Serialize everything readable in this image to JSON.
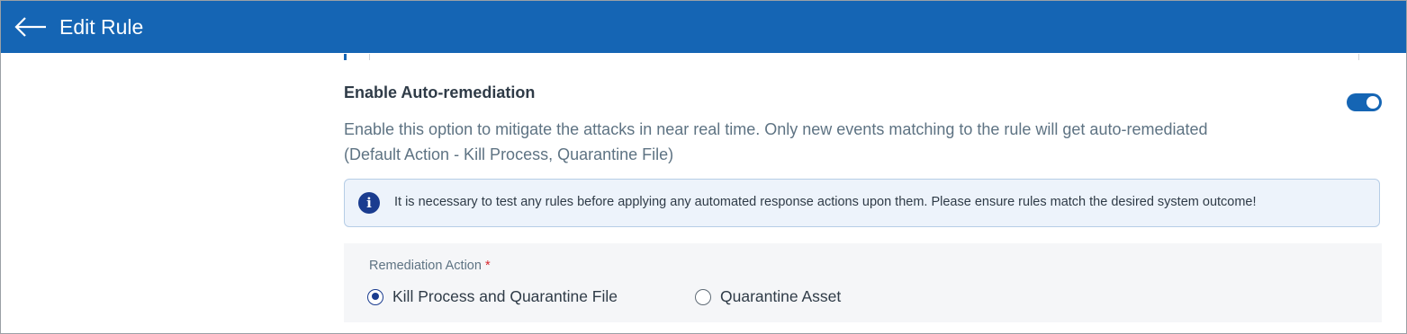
{
  "header": {
    "title": "Edit Rule",
    "back_icon": "arrow-left-icon",
    "background": "#1565b4"
  },
  "auto_remediation": {
    "title": "Enable Auto-remediation",
    "description_line1": "Enable this option to mitigate the attacks in near real time. Only new events matching to the rule will get auto-remediated",
    "description_line2": "(Default Action - Kill Process, Quarantine File)",
    "enabled": true
  },
  "info_banner": {
    "icon": "info-icon",
    "message": "It is necessary to test any rules before applying any automated response actions upon them. Please ensure rules match the desired system outcome!"
  },
  "remediation_action": {
    "label": "Remediation Action",
    "required_marker": "*",
    "options": [
      {
        "label": "Kill Process and Quarantine File",
        "selected": true
      },
      {
        "label": "Quarantine Asset",
        "selected": false
      }
    ]
  }
}
